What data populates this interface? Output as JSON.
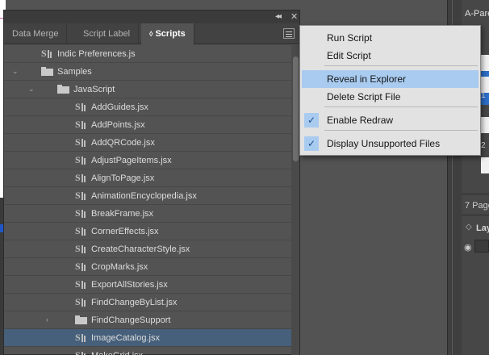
{
  "panel": {
    "tabs": [
      {
        "label": "Data Merge",
        "active": false
      },
      {
        "label": "Script Label",
        "active": false
      },
      {
        "label": "Scripts",
        "active": true
      }
    ],
    "tree": [
      {
        "label": "Indic Preferences.js",
        "type": "script",
        "depth": 1,
        "disclosure": ""
      },
      {
        "label": "Samples",
        "type": "folder",
        "depth": 1,
        "disclosure": "expanded"
      },
      {
        "label": "JavaScript",
        "type": "folder",
        "depth": 2,
        "disclosure": "expanded"
      },
      {
        "label": "AddGuides.jsx",
        "type": "script",
        "depth": 3,
        "disclosure": ""
      },
      {
        "label": "AddPoints.jsx",
        "type": "script",
        "depth": 3,
        "disclosure": ""
      },
      {
        "label": "AddQRCode.jsx",
        "type": "script",
        "depth": 3,
        "disclosure": ""
      },
      {
        "label": "AdjustPageItems.jsx",
        "type": "script",
        "depth": 3,
        "disclosure": ""
      },
      {
        "label": "AlignToPage.jsx",
        "type": "script",
        "depth": 3,
        "disclosure": ""
      },
      {
        "label": "AnimationEncyclopedia.jsx",
        "type": "script",
        "depth": 3,
        "disclosure": ""
      },
      {
        "label": "BreakFrame.jsx",
        "type": "script",
        "depth": 3,
        "disclosure": ""
      },
      {
        "label": "CornerEffects.jsx",
        "type": "script",
        "depth": 3,
        "disclosure": ""
      },
      {
        "label": "CreateCharacterStyle.jsx",
        "type": "script",
        "depth": 3,
        "disclosure": ""
      },
      {
        "label": "CropMarks.jsx",
        "type": "script",
        "depth": 3,
        "disclosure": ""
      },
      {
        "label": "ExportAllStories.jsx",
        "type": "script",
        "depth": 3,
        "disclosure": ""
      },
      {
        "label": "FindChangeByList.jsx",
        "type": "script",
        "depth": 3,
        "disclosure": ""
      },
      {
        "label": "FindChangeSupport",
        "type": "folder",
        "depth": 3,
        "disclosure": "collapsed"
      },
      {
        "label": "ImageCatalog.jsx",
        "type": "script",
        "depth": 3,
        "disclosure": "",
        "selected": true
      },
      {
        "label": "MakeGrid.jsx",
        "type": "script",
        "depth": 3,
        "disclosure": ""
      }
    ]
  },
  "flyout": {
    "items": [
      {
        "label": "Run Script",
        "checked": false,
        "highlighted": false
      },
      {
        "label": "Edit Script",
        "checked": false,
        "highlighted": false
      },
      {
        "label": "Reveal in Explorer",
        "checked": false,
        "highlighted": true
      },
      {
        "label": "Delete Script File",
        "checked": false,
        "highlighted": false
      },
      {
        "label": "Enable Redraw",
        "checked": true,
        "highlighted": false
      },
      {
        "label": "Display Unsupported Files",
        "checked": true,
        "highlighted": false
      }
    ]
  },
  "pages_panel": {
    "parent_label": "A-Pare",
    "page_numbers": [
      "1",
      "2"
    ],
    "pages_count": "7 Page",
    "layers_label": "Lay"
  },
  "colors": {
    "selection": "#46607b",
    "menu_highlight": "#a9cbf0",
    "page_selection": "#2d6ec8"
  }
}
